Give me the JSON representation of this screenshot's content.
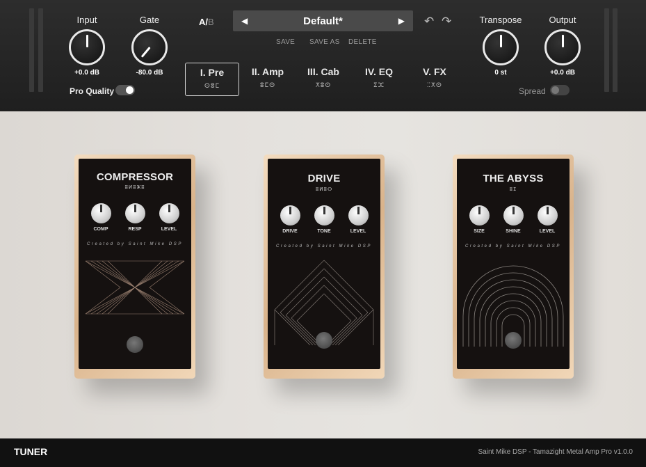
{
  "header": {
    "input": {
      "label": "Input",
      "value": "+0.0 dB"
    },
    "gate": {
      "label": "Gate",
      "value": "-80.0 dB"
    },
    "transpose": {
      "label": "Transpose",
      "value": "0 st"
    },
    "output": {
      "label": "Output",
      "value": "+0.0 dB"
    },
    "pro_quality": {
      "label": "Pro Quality",
      "on": true
    },
    "spread": {
      "label": "Spread",
      "on": false
    },
    "ab": {
      "a": "A",
      "sep": "/",
      "b": "B"
    },
    "preset": {
      "name": "Default*",
      "prev": "◀",
      "next": "▶",
      "save": "SAVE",
      "save_as": "SAVE AS",
      "delete": "DELETE"
    },
    "undo_icon": "↶",
    "redo_icon": "↷"
  },
  "tabs": [
    {
      "label": "I. Pre",
      "sub": "ⵙⵓⵎ"
    },
    {
      "label": "II. Amp",
      "sub": "ⵓⵎⵙ"
    },
    {
      "label": "III. Cab",
      "sub": "ⵅⵓⵙ"
    },
    {
      "label": "IV. EQ",
      "sub": "ⵉⵋ"
    },
    {
      "label": "V. FX",
      "sub": "ⵆⵅⵙ"
    }
  ],
  "pedals": [
    {
      "title": "COMPRESSOR",
      "sub": "ⵓⵍⵓⵣⵓ",
      "knobs": [
        "COMP",
        "RESP",
        "LEVEL"
      ],
      "credit": "Created by Saint Mike DSP"
    },
    {
      "title": "DRIVE",
      "sub": "ⵓⵍⵓⵙ",
      "knobs": [
        "DRIVE",
        "TONE",
        "LEVEL"
      ],
      "credit": "Created by Saint Mike DSP"
    },
    {
      "title": "THE ABYSS",
      "sub": "ⵓⵉ",
      "knobs": [
        "SIZE",
        "SHINE",
        "LEVEL"
      ],
      "credit": "Created by Saint Mike DSP"
    }
  ],
  "footer": {
    "tuner": "TUNER",
    "version": "Saint Mike DSP - Tamazight Metal Amp Pro v1.0.0"
  }
}
